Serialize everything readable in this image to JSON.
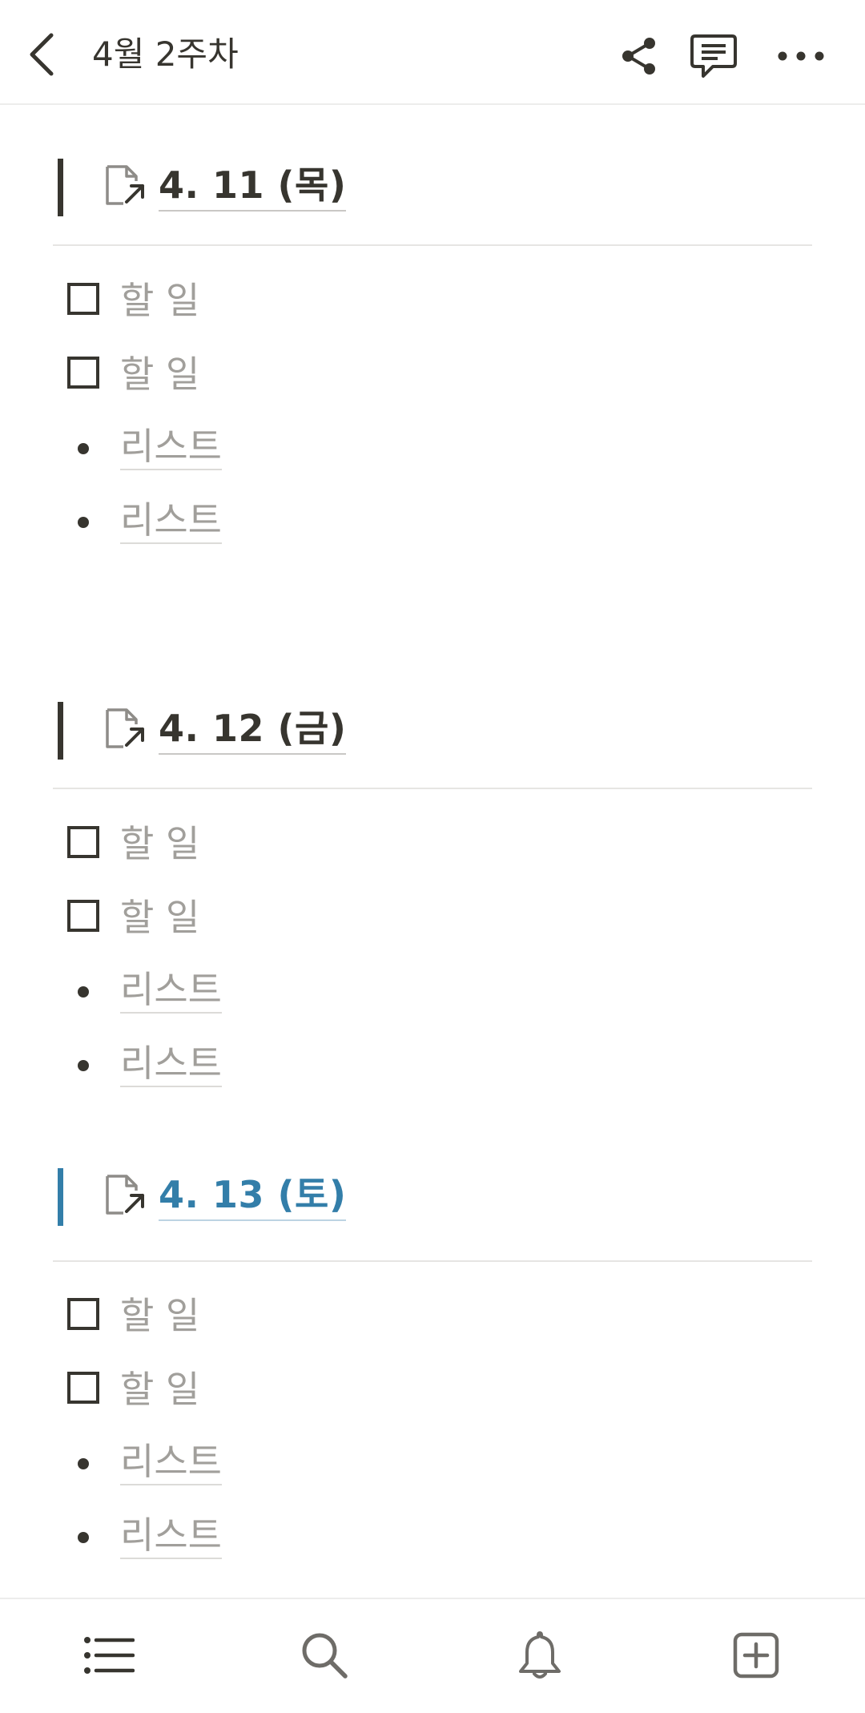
{
  "header": {
    "title": "4월 2주차",
    "icons": [
      "back-arrow-icon",
      "share-icon",
      "comment-icon",
      "more-icon"
    ]
  },
  "sections": [
    {
      "title": "4. 11 (목)",
      "icon": "page-link-icon",
      "color": "#37352f",
      "items": [
        {
          "type": "todo",
          "text": "할 일"
        },
        {
          "type": "todo",
          "text": "할 일"
        },
        {
          "type": "bullet",
          "text": "리스트"
        },
        {
          "type": "bullet",
          "text": "리스트"
        }
      ]
    },
    {
      "title": "4. 12 (금)",
      "icon": "page-link-icon",
      "color": "#37352f",
      "items": [
        {
          "type": "todo",
          "text": "할 일"
        },
        {
          "type": "todo",
          "text": "할 일"
        },
        {
          "type": "bullet",
          "text": "리스트"
        },
        {
          "type": "bullet",
          "text": "리스트"
        }
      ]
    },
    {
      "title": "4. 13 (토)",
      "icon": "page-link-icon",
      "color": "#337ea9",
      "items": [
        {
          "type": "todo",
          "text": "할 일"
        },
        {
          "type": "todo",
          "text": "할 일"
        },
        {
          "type": "bullet",
          "text": "리스트"
        },
        {
          "type": "bullet",
          "text": "리스트"
        }
      ]
    }
  ],
  "bottom_nav": {
    "icons": [
      "list-icon",
      "search-icon",
      "bell-icon",
      "new-page-icon"
    ]
  },
  "colors": {
    "text": "#37352f",
    "placeholder": "#a19f9b",
    "accent_blue": "#337ea9",
    "divider": "#e6e5e3"
  }
}
